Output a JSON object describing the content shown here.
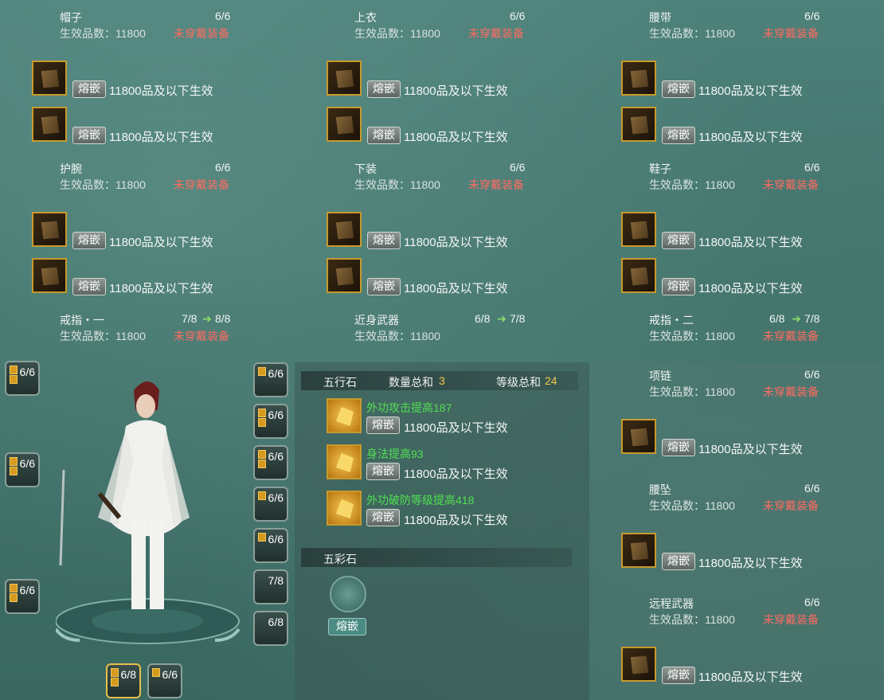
{
  "equip": [
    {
      "title": "帽子",
      "count": "6/6",
      "quality": "生效品数：11800",
      "warn": "未穿戴装备"
    },
    {
      "title": "上衣",
      "count": "6/6",
      "quality": "生效品数：11800",
      "warn": "未穿戴装备"
    },
    {
      "title": "腰带",
      "count": "6/6",
      "quality": "生效品数：11800",
      "warn": "未穿戴装备"
    },
    {
      "title": "护腕",
      "count": "6/6",
      "quality": "生效品数：11800",
      "warn": "未穿戴装备"
    },
    {
      "title": "下装",
      "count": "6/6",
      "quality": "生效品数：11800",
      "warn": "未穿戴装备"
    },
    {
      "title": "鞋子",
      "count": "6/6",
      "quality": "生效品数：11800",
      "warn": "未穿戴装备"
    }
  ],
  "ring1": {
    "title": "戒指・一",
    "count": "7/8",
    "next": "8/8",
    "quality": "生效品数：11800",
    "warn": "未穿戴装备"
  },
  "weapon": {
    "title": "近身武器",
    "count": "6/8",
    "next": "7/8",
    "quality": "生效品数：11800"
  },
  "ring2": {
    "title": "戒指・二",
    "count": "6/8",
    "next": "7/8",
    "quality": "生效品数：11800",
    "warn": "未穿戴装备"
  },
  "necklace": {
    "title": "项链",
    "count": "6/6",
    "quality": "生效品数：11800",
    "warn": "未穿戴装备"
  },
  "pendant": {
    "title": "腰坠",
    "count": "6/6",
    "quality": "生效品数：11800",
    "warn": "未穿戴装备"
  },
  "ranged": {
    "title": "远程武器",
    "count": "6/6",
    "quality": "生效品数：11800",
    "warn": "未穿戴装备"
  },
  "inlay_label": "熔嵌",
  "effect_text": "11800品及以下生效",
  "wuxing": {
    "label": "五行石",
    "qty_label": "数量总和",
    "qty": "3",
    "lvl_label": "等级总和",
    "lvl": "24",
    "stones": [
      {
        "name": "外功攻击提高187"
      },
      {
        "name": "身法提高93"
      },
      {
        "name": "外功破防等级提高418"
      }
    ]
  },
  "wucai": {
    "label": "五彩石",
    "button": "熔嵌"
  },
  "left_slots": [
    "6/6",
    "6/6",
    "6/6"
  ],
  "right_slots": [
    "6/6",
    "6/6",
    "6/6",
    "6/6",
    "6/6",
    "7/8",
    "6/8"
  ],
  "bottom_slots": [
    "6/8",
    "6/6"
  ]
}
